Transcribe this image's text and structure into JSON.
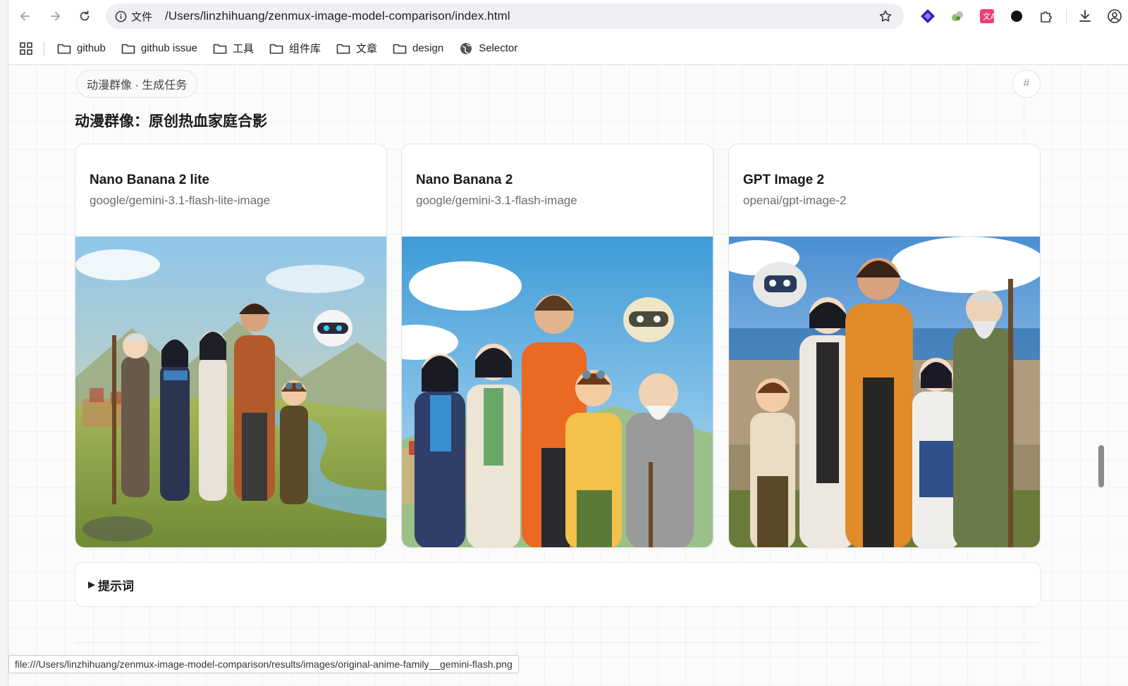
{
  "browser": {
    "address": {
      "scheme_label": "文件",
      "url": "/Users/linzhihuang/zenmux-image-model-comparison/index.html"
    },
    "bookmarks": [
      {
        "label": "github",
        "icon": "folder-icon"
      },
      {
        "label": "github issue",
        "icon": "folder-icon"
      },
      {
        "label": "工具",
        "icon": "folder-icon"
      },
      {
        "label": "组件库",
        "icon": "folder-icon"
      },
      {
        "label": "文章",
        "icon": "folder-icon"
      },
      {
        "label": "design",
        "icon": "folder-icon"
      },
      {
        "label": "Selector",
        "icon": "globe-icon"
      }
    ],
    "status_url": "file:///Users/linzhihuang/zenmux-image-model-comparison/results/images/original-anime-family__gemini-flash.png"
  },
  "page": {
    "task_pill": "动漫群像 · 生成任务",
    "hash_label": "#",
    "section_title": "动漫群像：原创热血家庭合影",
    "cards": [
      {
        "name": "Nano Banana 2 lite",
        "model_id": "google/gemini-3.1-flash-lite-image"
      },
      {
        "name": "Nano Banana 2",
        "model_id": "google/gemini-3.1-flash-image"
      },
      {
        "name": "GPT Image 2",
        "model_id": "openai/gpt-image-2"
      }
    ],
    "prompt_toggle": "提示词",
    "prompt_triangle": "▶"
  },
  "colors": {
    "accent": "#1a1a1a",
    "muted": "#6b6b6b"
  }
}
